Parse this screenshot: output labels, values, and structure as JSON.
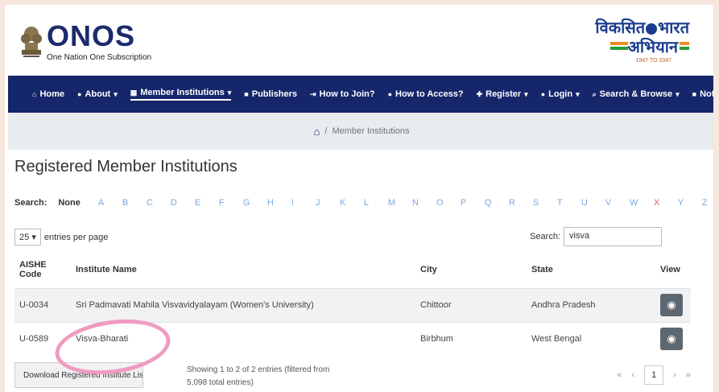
{
  "header": {
    "logo_title": "ONOS",
    "logo_subtitle": "One Nation One Subscription",
    "vb_line1": "विकसित",
    "vb_line1b": "भारत",
    "vb_line2": "अभियान",
    "vb_years": "1947 TO 2047"
  },
  "nav": {
    "items": [
      {
        "icon": "home-icon",
        "glyph": "⌂",
        "label": "Home",
        "has_caret": false
      },
      {
        "icon": "info-icon",
        "glyph": "●",
        "label": "About",
        "has_caret": true
      },
      {
        "icon": "institution-icon",
        "glyph": "▦",
        "label": "Member Institutions",
        "has_caret": true,
        "active": true
      },
      {
        "icon": "book-icon",
        "glyph": "■",
        "label": "Publishers",
        "has_caret": false
      },
      {
        "icon": "sign-in-icon",
        "glyph": "⇥",
        "label": "How to Join?",
        "has_caret": false
      },
      {
        "icon": "help-icon",
        "glyph": "●",
        "label": "How to Access?",
        "has_caret": false
      },
      {
        "icon": "user-plus-icon",
        "glyph": "✚",
        "label": "Register",
        "has_caret": true
      },
      {
        "icon": "login-icon",
        "glyph": "●",
        "label": "Login",
        "has_caret": true
      },
      {
        "icon": "search-icon",
        "glyph": "⌕",
        "label": "Search & Browse",
        "has_caret": true
      },
      {
        "icon": "notice-icon",
        "glyph": "■",
        "label": "Notices",
        "has_caret": false
      }
    ]
  },
  "breadcrumb": {
    "separator": "/",
    "current": "Member Institutions"
  },
  "page_title": "Registered Member Institutions",
  "alpha_filter": {
    "label": "Search:",
    "none": "None",
    "letters": [
      "A",
      "B",
      "C",
      "D",
      "E",
      "F",
      "G",
      "H",
      "I",
      "J",
      "K",
      "L",
      "M",
      "N",
      "O",
      "P",
      "Q",
      "R",
      "S",
      "T",
      "U",
      "V",
      "W",
      "X",
      "Y",
      "Z"
    ],
    "highlighted": "X"
  },
  "entries": {
    "value": "25",
    "suffix": "entries per page"
  },
  "search": {
    "label": "Search:",
    "value": "visva"
  },
  "table": {
    "headers": {
      "code_line1": "AISHE",
      "code_line2": "Code",
      "name": "Institute Name",
      "city": "City",
      "state": "State",
      "view": "View"
    },
    "rows": [
      {
        "code": "U-0034",
        "name": "Sri Padmavati Mahila Visvavidyalayam (Women's University)",
        "city": "Chittoor",
        "state": "Andhra Pradesh"
      },
      {
        "code": "U-0589",
        "name": "Visva-Bharati",
        "city": "Birbhum",
        "state": "West Bengal"
      }
    ]
  },
  "footer": {
    "download_label": "Download Registered Institute List",
    "showing": "Showing 1 to 2 of 2 entries (filtered from 5,098 total entries)",
    "pager": {
      "first": "«",
      "prev": "‹",
      "current": "1",
      "next": "›",
      "last": "»"
    }
  },
  "colors": {
    "nav_bg": "#16266b",
    "annotation_circle": "#f09bc2",
    "letter": "#7aa7e6",
    "letter_highlight": "#e25a5a"
  }
}
